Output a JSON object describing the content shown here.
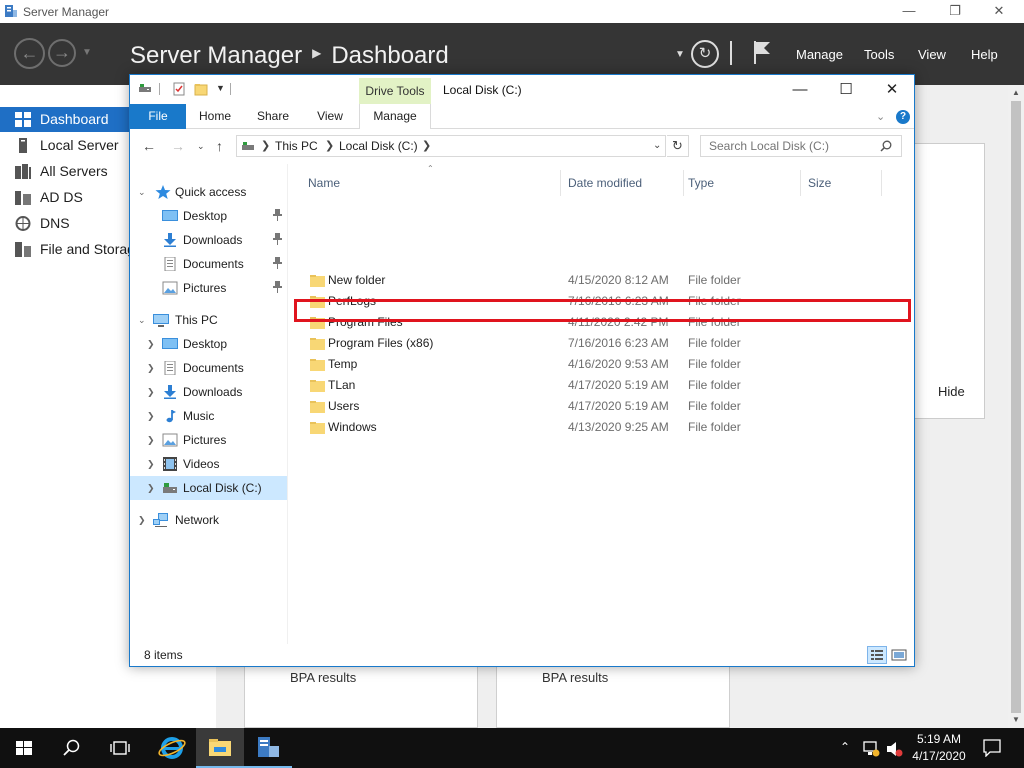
{
  "server_manager": {
    "window_title": "Server Manager",
    "breadcrumb": {
      "root": "Server Manager",
      "page": "Dashboard"
    },
    "menu": [
      "Manage",
      "Tools",
      "View",
      "Help"
    ],
    "sidebar": [
      {
        "label": "Dashboard",
        "icon": "dashboard-icon",
        "active": true
      },
      {
        "label": "Local Server",
        "icon": "local-server-icon"
      },
      {
        "label": "All Servers",
        "icon": "all-servers-icon"
      },
      {
        "label": "AD DS",
        "icon": "ad-ds-icon"
      },
      {
        "label": "DNS",
        "icon": "dns-icon"
      },
      {
        "label": "File and Storag",
        "icon": "file-storage-icon"
      }
    ],
    "hide_label": "Hide",
    "bpa_cards": [
      "BPA results",
      "BPA results"
    ]
  },
  "explorer": {
    "title": "Local Disk (C:)",
    "ribbon": {
      "context_group": "Drive Tools",
      "tabs": [
        "File",
        "Home",
        "Share",
        "View",
        "Manage"
      ]
    },
    "address": {
      "segments": [
        "This PC",
        "Local Disk (C:)"
      ]
    },
    "search": {
      "placeholder": "Search Local Disk (C:)"
    },
    "nav": {
      "quick_access": {
        "label": "Quick access",
        "items": [
          "Desktop",
          "Downloads",
          "Documents",
          "Pictures"
        ]
      },
      "this_pc": {
        "label": "This PC",
        "items": [
          "Desktop",
          "Documents",
          "Downloads",
          "Music",
          "Pictures",
          "Videos",
          "Local Disk (C:)"
        ]
      },
      "network": "Network"
    },
    "columns": [
      "Name",
      "Date modified",
      "Type",
      "Size"
    ],
    "rows": [
      {
        "name": "New folder",
        "date": "4/15/2020 8:12 AM",
        "type": "File folder"
      },
      {
        "name": "PerfLogs",
        "date": "7/16/2016 6:23 AM",
        "type": "File folder"
      },
      {
        "name": "Program Files",
        "date": "4/11/2020 2:42 PM",
        "type": "File folder"
      },
      {
        "name": "Program Files (x86)",
        "date": "7/16/2016 6:23 AM",
        "type": "File folder"
      },
      {
        "name": "Temp",
        "date": "4/16/2020 9:53 AM",
        "type": "File folder"
      },
      {
        "name": "TLan",
        "date": "4/17/2020 5:19 AM",
        "type": "File folder"
      },
      {
        "name": "Users",
        "date": "4/17/2020 5:19 AM",
        "type": "File folder"
      },
      {
        "name": "Windows",
        "date": "4/13/2020 9:25 AM",
        "type": "File folder"
      }
    ],
    "status": {
      "item_count": "8 items"
    }
  },
  "taskbar": {
    "clock": {
      "time": "5:19 AM",
      "date": "4/17/2020"
    }
  },
  "colors": {
    "accent": "#1979ca",
    "sm_header": "#353535",
    "sidebar_active": "#1f6fc5",
    "highlight": "#e0141e",
    "folder": "#f8d775",
    "drive_tools": "#e2f2c5"
  }
}
